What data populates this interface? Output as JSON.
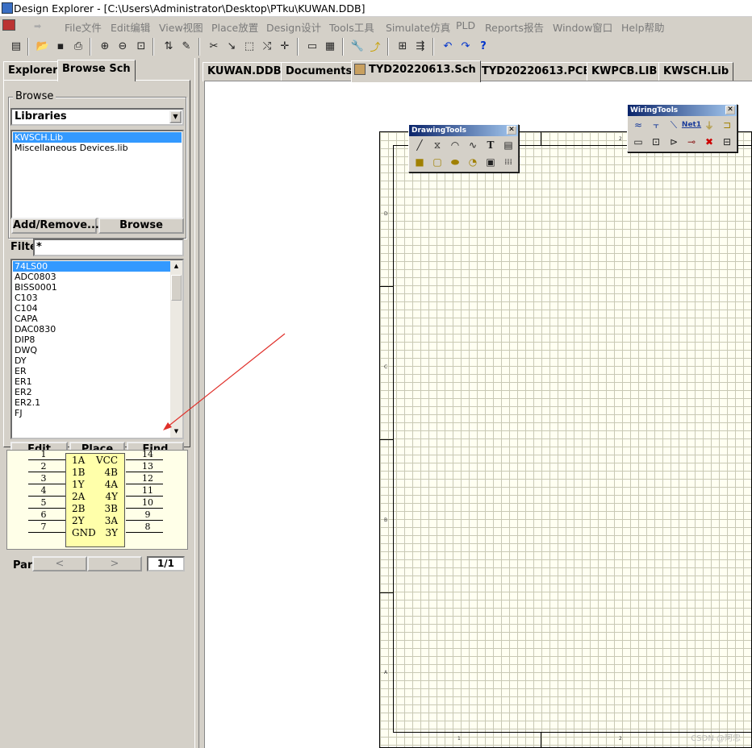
{
  "window": {
    "title": "Design Explorer - [C:\\Users\\Administrator\\Desktop\\PTku\\KUWAN.DDB]"
  },
  "menu": [
    "File文件",
    "Edit编辑",
    "View视图",
    "Place放置",
    "Design设计",
    "Tools工具",
    "Simulate仿真",
    "PLD",
    "Reports报告",
    "Window窗口",
    "Help帮助"
  ],
  "toolbar": {
    "icons": [
      "design-manager-icon",
      "open-icon",
      "save-icon",
      "print-icon",
      "zoom-in-icon",
      "zoom-out-icon",
      "zoom-fit-icon",
      "hierarchy-icon",
      "probe-icon",
      "cut-icon",
      "paste-icon",
      "select-area-icon",
      "deselect-icon",
      "move-icon",
      "browse-sheet-icon",
      "component-icon",
      "wrench-icon",
      "autorouter-icon",
      "library-icon",
      "netlist-icon",
      "undo-icon",
      "redo-icon",
      "help-icon"
    ]
  },
  "sidebar": {
    "tabs": [
      "Explorer",
      "Browse Sch"
    ],
    "browse_label": "Browse",
    "browse_type": "Libraries",
    "libraries": [
      "KWSCH.Lib",
      "Miscellaneous Devices.lib"
    ],
    "add_remove_label": "Add/Remove...",
    "browse_button_label": "Browse",
    "filter_label": "Filte",
    "filter_value": "*",
    "components": [
      "74LS00",
      "ADC0803",
      "BISS0001",
      "C103",
      "C104",
      "CAPA",
      "DAC0830",
      "DIP8",
      "DWQ",
      "DY",
      "ER",
      "ER1",
      "ER2",
      "ER2.1",
      "FJ"
    ],
    "edit_label": "Edit",
    "place_label": "Place",
    "find_label": "Find",
    "part_label": "Part",
    "part_prev": "<",
    "part_next": ">",
    "part_value": "1/1"
  },
  "preview": {
    "left_pins": [
      {
        "num": "1",
        "name": "1A"
      },
      {
        "num": "2",
        "name": "1B"
      },
      {
        "num": "3",
        "name": "1Y"
      },
      {
        "num": "4",
        "name": "2A"
      },
      {
        "num": "5",
        "name": "2B"
      },
      {
        "num": "6",
        "name": "2Y"
      },
      {
        "num": "7",
        "name": "GND"
      }
    ],
    "right_pins": [
      {
        "num": "14",
        "name": "VCC"
      },
      {
        "num": "13",
        "name": "4B"
      },
      {
        "num": "12",
        "name": "4A"
      },
      {
        "num": "11",
        "name": "4Y"
      },
      {
        "num": "10",
        "name": "3B"
      },
      {
        "num": "9",
        "name": "3A"
      },
      {
        "num": "8",
        "name": "3Y"
      }
    ]
  },
  "document_tabs": [
    "KUWAN.DDB",
    "Documents",
    "TYD20220613.Sch",
    "TYD20220613.PCB",
    "KWPCB.LIB",
    "KWSCH.Lib"
  ],
  "drawing_tools": {
    "title": "DrawingTools",
    "icons": [
      "line-icon",
      "polygon-icon",
      "arc-icon",
      "bezier-icon",
      "text-icon",
      "text-frame-icon",
      "rectangle-icon",
      "rounded-rectangle-icon",
      "ellipse-icon",
      "pie-icon",
      "graphic-icon",
      "array-icon"
    ]
  },
  "wiring_tools": {
    "title": "WiringTools",
    "net_label": "Net1",
    "icons": [
      "wire-icon",
      "bus-icon",
      "bus-entry-icon",
      "net-label-icon",
      "ground-icon",
      "port-icon",
      "part-icon",
      "sheet-symbol-icon",
      "sheet-entry-icon",
      "junction-icon",
      "no-erc-icon",
      "pcb-layout-icon"
    ]
  },
  "sheet": {
    "zones_vertical": [
      "D",
      "C",
      "B",
      "A"
    ],
    "zones_horizontal": [
      "1",
      "2"
    ]
  },
  "watermark": "CSDN @阿忠"
}
